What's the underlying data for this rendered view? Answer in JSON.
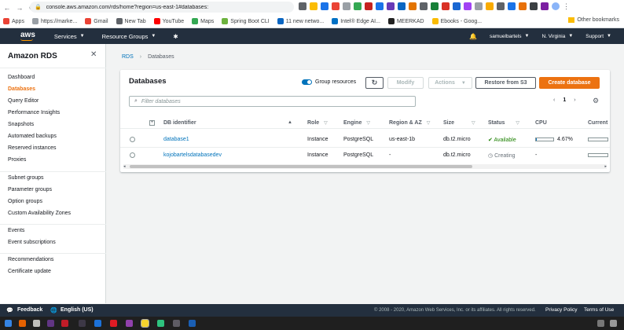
{
  "browser": {
    "url": "console.aws.amazon.com/rds/home?region=us-east-1#databases:",
    "bookmarks": [
      {
        "label": "Apps",
        "color": "#ea4335"
      },
      {
        "label": "https://marke...",
        "color": "#9aa0a6"
      },
      {
        "label": "Gmail",
        "color": "#ea4335"
      },
      {
        "label": "New Tab",
        "color": "#5f6368"
      },
      {
        "label": "YouTube",
        "color": "#ff0000"
      },
      {
        "label": "Maps",
        "color": "#34a853"
      },
      {
        "label": "Spring Boot CLI",
        "color": "#6db33f"
      },
      {
        "label": "11 new netwo...",
        "color": "#0a66c2"
      },
      {
        "label": "Intel® Edge AI...",
        "color": "#0071c5"
      },
      {
        "label": "MEERKAD",
        "color": "#222222"
      },
      {
        "label": "Ebooks - Goog...",
        "color": "#fbbc04"
      }
    ],
    "other_bookmarks": "Other bookmarks"
  },
  "awsnav": {
    "logo": "aws",
    "services": "Services",
    "resource_groups": "Resource Groups",
    "user": "samuelbartels",
    "region": "N. Virginia",
    "support": "Support"
  },
  "sidebar": {
    "title": "Amazon RDS",
    "groups": [
      [
        "Dashboard",
        "Databases",
        "Query Editor",
        "Performance Insights",
        "Snapshots",
        "Automated backups",
        "Reserved instances",
        "Proxies"
      ],
      [
        "Subnet groups",
        "Parameter groups",
        "Option groups",
        "Custom Availability Zones"
      ],
      [
        "Events",
        "Event subscriptions"
      ],
      [
        "Recommendations",
        "Certificate update"
      ]
    ],
    "active": "Databases"
  },
  "breadcrumb": {
    "root": "RDS",
    "current": "Databases"
  },
  "panel": {
    "title": "Databases",
    "group_resources": "Group resources",
    "modify": "Modify",
    "actions": "Actions",
    "restore": "Restore from S3",
    "create": "Create database",
    "filter_placeholder": "Filter databases",
    "page": "1"
  },
  "table": {
    "columns": {
      "id": "DB identifier",
      "role": "Role",
      "engine": "Engine",
      "region": "Region & AZ",
      "size": "Size",
      "status": "Status",
      "cpu": "CPU",
      "current": "Current"
    },
    "rows": [
      {
        "id": "database1",
        "role": "Instance",
        "engine": "PostgreSQL",
        "region": "us-east-1b",
        "size": "db.t2.micro",
        "status": "Available",
        "cpu_text": "4.67%",
        "cpu_pct": 4.67
      },
      {
        "id": "kojobartelsdatabasedev",
        "role": "Instance",
        "engine": "PostgreSQL",
        "region": "-",
        "size": "db.t2.micro",
        "status": "Creating",
        "cpu_text": "-",
        "cpu_pct": 0
      }
    ]
  },
  "footer": {
    "feedback": "Feedback",
    "language": "English (US)",
    "copyright": "© 2008 - 2020, Amazon Web Services, Inc. or its affiliates. All rights reserved.",
    "privacy": "Privacy Policy",
    "terms": "Terms of Use"
  },
  "colors": {
    "accent": "#ec7211",
    "link": "#0073bb",
    "nav": "#232f3e",
    "ok": "#1d8102"
  }
}
